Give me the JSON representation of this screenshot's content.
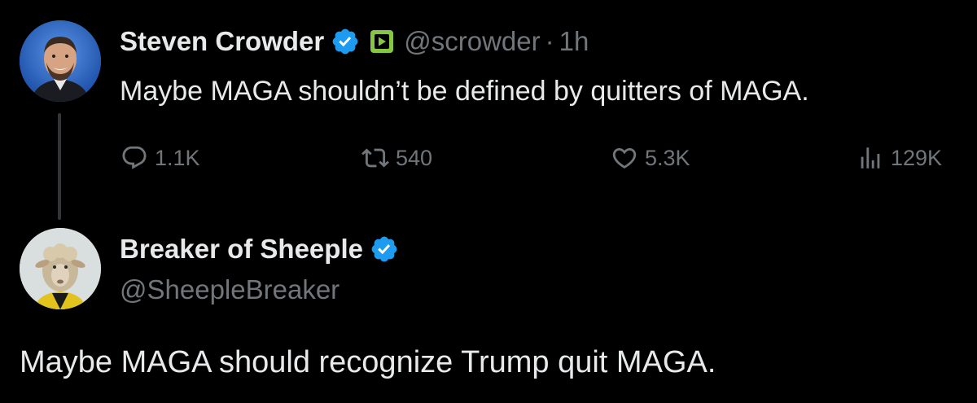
{
  "colors": {
    "background": "#000000",
    "text_primary": "#e7e9ea",
    "text_secondary": "#71767b",
    "verified_blue": "#1d9bf0",
    "rumble_green": "#85c742"
  },
  "tweet1": {
    "display_name": "Steven Crowder",
    "verified_icon": "verified-badge-icon",
    "extra_icon": "rumble-icon",
    "handle": "@scrowder",
    "separator": "·",
    "time": "1h",
    "text": "Maybe MAGA shouldn’t be defined by quitters of MAGA.",
    "actions": {
      "replies": "1.1K",
      "reposts": "540",
      "likes": "5.3K",
      "views": "129K"
    }
  },
  "tweet2": {
    "display_name": "Breaker of Sheeple",
    "verified_icon": "verified-badge-icon",
    "handle": "@SheepleBreaker",
    "text": "Maybe MAGA should recognize Trump quit MAGA."
  }
}
